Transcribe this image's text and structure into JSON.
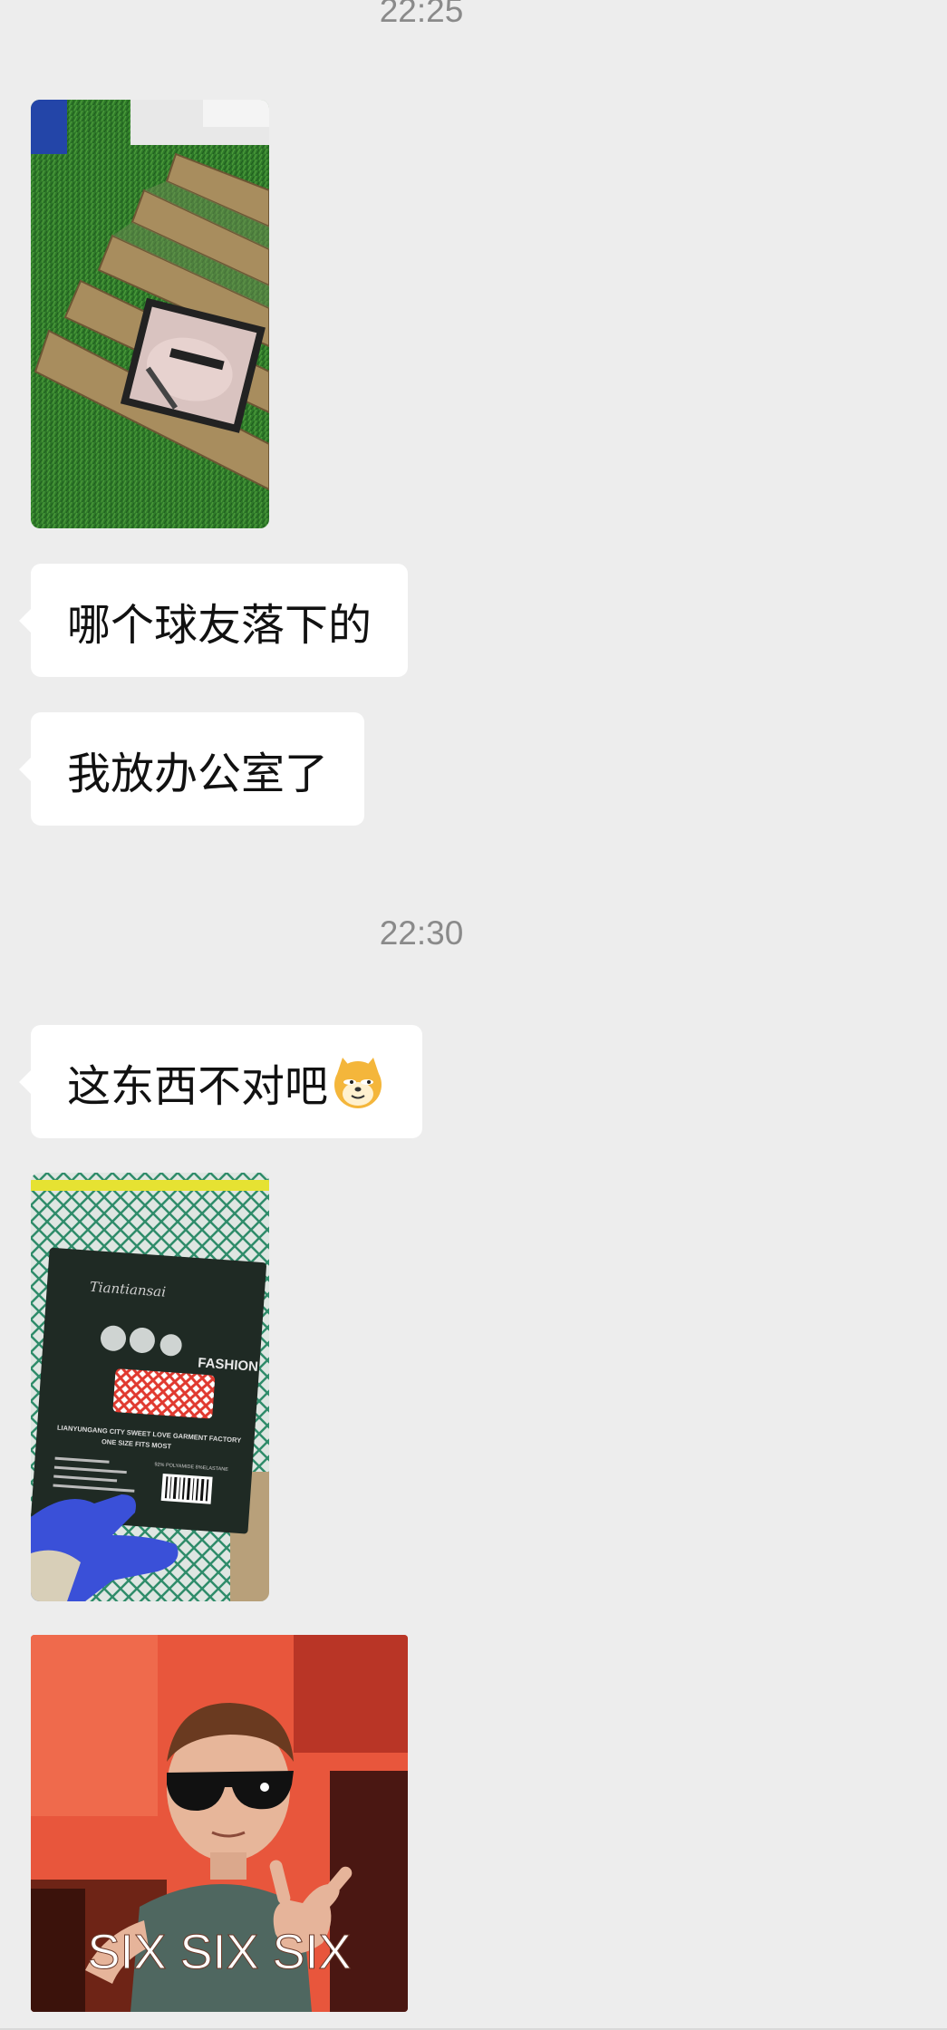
{
  "timestamps": [
    "22:25",
    "22:30"
  ],
  "messages": {
    "text1": "哪个球友落下的",
    "text2": "我放办公室了",
    "text3": "这东西不对吧"
  },
  "emoji": "doge-cat-emoji",
  "photos": {
    "package_brand": "Tiantiansai",
    "package_label": "FASHION",
    "package_line1": "LIANYUNGANG CITY SWEET LOVE GARMENT FACTORY",
    "package_line2": "ONE SIZE FITS MOST",
    "package_material": "92% POLYAMIDE 8%ELASTANE"
  },
  "sticker": {
    "caption": "SIX SIX SIX"
  },
  "colors": {
    "background": "#ededed",
    "bubble": "#ffffff",
    "timestamp": "#8a8a8a"
  }
}
